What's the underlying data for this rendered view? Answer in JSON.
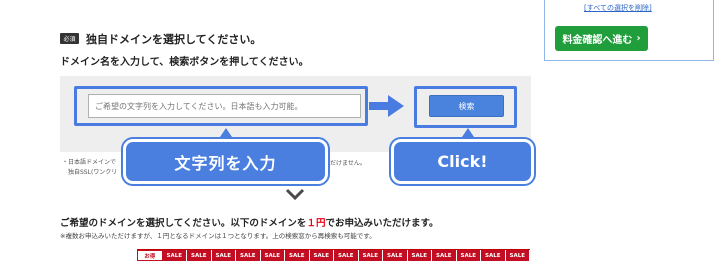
{
  "sidebar": {
    "clear_link": "[すべての選択を削除]",
    "confirm_button": "料金確認へ進む",
    "confirm_arrow": "›"
  },
  "header": {
    "badge": "必須",
    "title": "独自ドメインを選択してください。",
    "subtitle": "ドメイン名を入力して、検索ボタンを押してください。"
  },
  "search": {
    "placeholder": "ご希望の文字列を入力してください。日本語も入力可能。",
    "button": "検索"
  },
  "notes": {
    "line1": "・日本語ドメインで",
    "line1_tail": "だけません。",
    "line2": "独自SSL(ワンクリ"
  },
  "callouts": {
    "input": "文字列を入力",
    "click": "Click!"
  },
  "results": {
    "heading_before": "ご希望のドメインを選択してください。以下のドメインを",
    "price": "１円",
    "heading_after": "でお申込みいただけます。",
    "note": "※複数お申込みいただけますが、１円となるドメインは１つとなります。上の検索窓から再検索も可能です。"
  },
  "table": {
    "first": "お得",
    "cells": [
      "SALE",
      "SALE",
      "SALE",
      "SALE",
      "SALE",
      "SALE",
      "SALE",
      "SALE",
      "SALE",
      "SALE",
      "SALE",
      "SALE",
      "SALE",
      "SALE",
      "SALE"
    ]
  }
}
